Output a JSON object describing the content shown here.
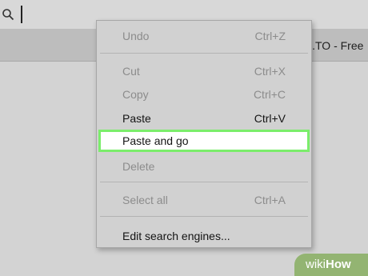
{
  "address_bar": {
    "icon": "search-icon"
  },
  "tab": {
    "title_fragment": "D.TO - Free"
  },
  "context_menu": {
    "items": [
      {
        "label": "Undo",
        "shortcut": "Ctrl+Z",
        "enabled": false
      },
      {
        "label": "Cut",
        "shortcut": "Ctrl+X",
        "enabled": false
      },
      {
        "label": "Copy",
        "shortcut": "Ctrl+C",
        "enabled": false
      },
      {
        "label": "Paste",
        "shortcut": "Ctrl+V",
        "enabled": true
      },
      {
        "label": "Paste and go",
        "shortcut": "",
        "enabled": true,
        "highlighted": true
      },
      {
        "label": "Delete",
        "shortcut": "",
        "enabled": false
      },
      {
        "label": "Select all",
        "shortcut": "Ctrl+A",
        "enabled": false
      },
      {
        "label": "Edit search engines...",
        "shortcut": "",
        "enabled": true
      }
    ],
    "highlight_color": "#7bed6b"
  },
  "watermark": {
    "wiki": "wiki",
    "how": "How",
    "color": "#93b472"
  }
}
